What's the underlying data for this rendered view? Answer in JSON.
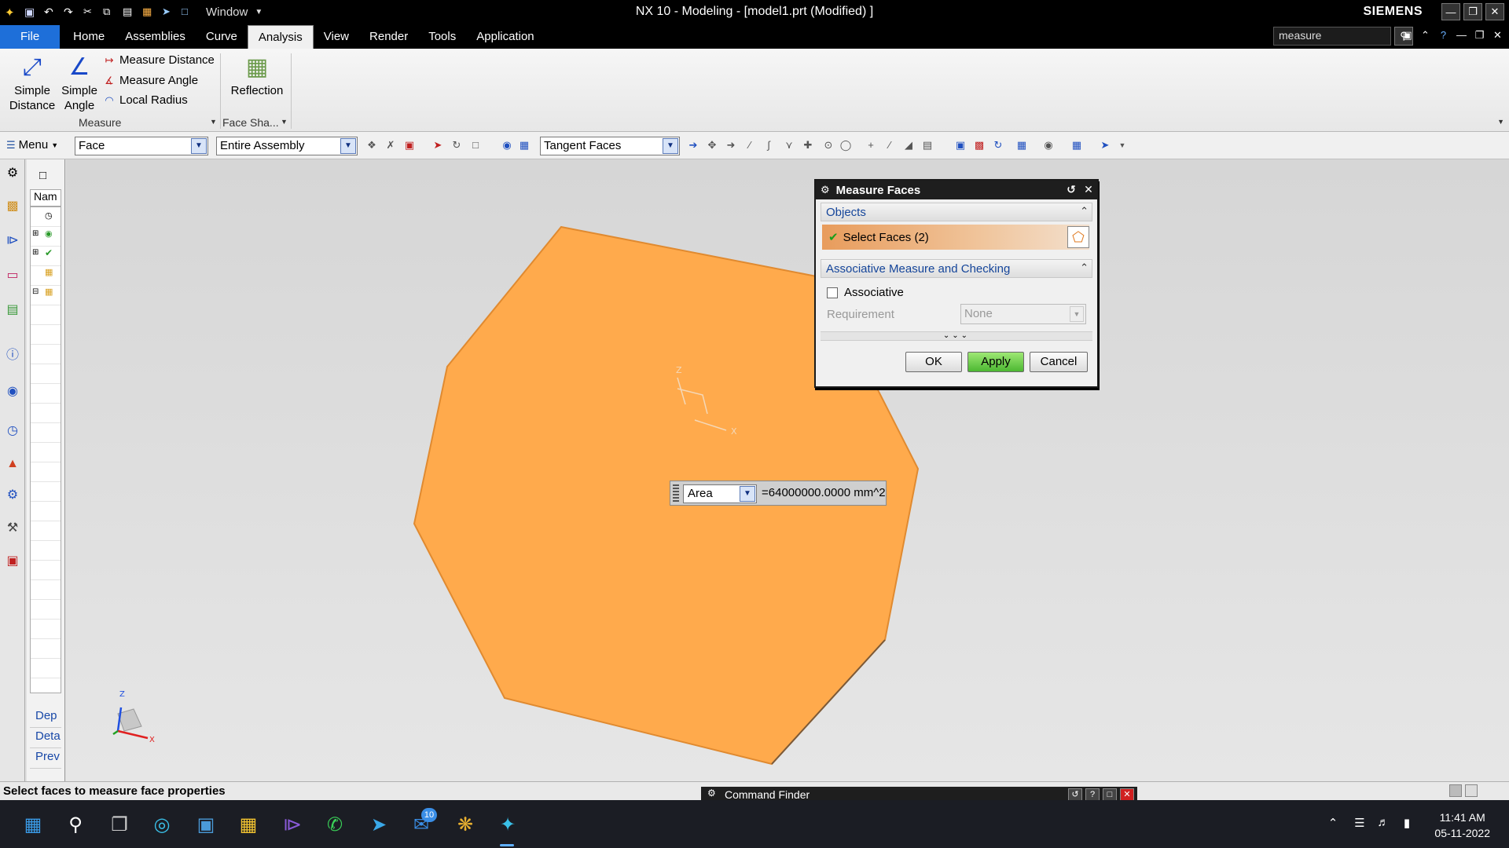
{
  "window": {
    "title": "NX 10 - Modeling - [model1.prt (Modified) ]",
    "brand": "SIEMENS",
    "window_menu": "Window"
  },
  "tabs": [
    "File",
    "Home",
    "Assemblies",
    "Curve",
    "Analysis",
    "View",
    "Render",
    "Tools",
    "Application"
  ],
  "active_tab": "Analysis",
  "search": {
    "value": "measure"
  },
  "ribbon": {
    "simple_distance": "Simple Distance",
    "simple_angle": "Simple Angle",
    "measure_distance": "Measure Distance",
    "measure_angle": "Measure Angle",
    "local_radius": "Local Radius",
    "reflection": "Reflection",
    "group_measure": "Measure",
    "group_face_shape": "Face Sha..."
  },
  "selection_bar": {
    "menu": "Menu",
    "type_filter": "Face",
    "scope": "Entire Assembly",
    "face_rule": "Tangent Faces"
  },
  "navigator": {
    "column": "Nam",
    "sections": [
      "Dep",
      "Deta",
      "Prev"
    ]
  },
  "dialog": {
    "title": "Measure Faces",
    "objects_section": "Objects",
    "select_faces": "Select Faces (2)",
    "assoc_section": "Associative Measure and Checking",
    "associative_label": "Associative",
    "associative_checked": false,
    "requirement_label": "Requirement",
    "requirement_value": "None",
    "ok": "OK",
    "apply": "Apply",
    "cancel": "Cancel"
  },
  "readout": {
    "measure_type": "Area",
    "value": "=64000000.0000 mm^2"
  },
  "status": "Select faces to measure face properties",
  "command_finder": "Command Finder",
  "taskbar": {
    "time": "11:41 AM",
    "date": "05-11-2022",
    "badge_count": "10"
  },
  "colors": {
    "face": "#ffaa4c",
    "face_edge": "#e08a30",
    "apply_button": "#58c23a",
    "file_tab": "#1e6fd9"
  }
}
